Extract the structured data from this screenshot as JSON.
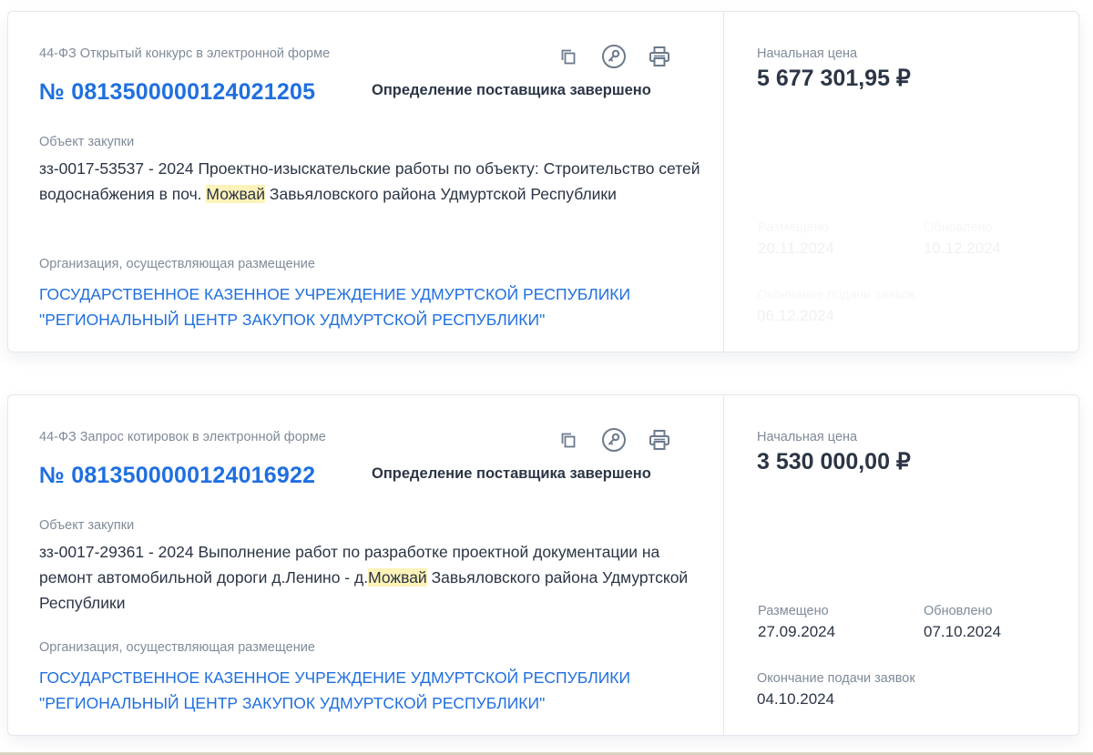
{
  "cards": [
    {
      "law_type": "44-ФЗ Открытый конкурс в электронной форме",
      "reg_number": "№ 0813500000124021205",
      "status": "Определение поставщика завершено",
      "object_label": "Объект закупки",
      "object_text_before": "зз-0017-53537 - 2024 Проектно-изыскательские работы по объекту: Строительство сетей водоснабжения в поч. ",
      "object_highlight": "Можвай",
      "object_text_after": " Завьяловского района Удмуртской Республики",
      "org_label": "Организация, осуществляющая размещение",
      "org_name": "ГОСУДАРСТВЕННОЕ КАЗЕННОЕ УЧРЕЖДЕНИЕ УДМУРТСКОЙ РЕСПУБЛИКИ \"РЕГИОНАЛЬНЫЙ ЦЕНТР ЗАКУПОК УДМУРТСКОЙ РЕСПУБЛИКИ\"",
      "price_label": "Начальная цена",
      "price": "5 677 301,95 ₽",
      "placed_label": "Размещено",
      "placed_date": "20.11.2024",
      "updated_label": "Обновлено",
      "updated_date": "10.12.2024",
      "end_label": "Окончание подачи заявок",
      "end_date": "06.12.2024"
    },
    {
      "law_type": "44-ФЗ Запрос котировок в электронной форме",
      "reg_number": "№ 0813500000124016922",
      "status": "Определение поставщика завершено",
      "object_label": "Объект закупки",
      "object_text_before": "зз-0017-29361 - 2024 Выполнение работ по разработке проектной документации на ремонт автомобильной дороги д.Ленино - д.",
      "object_highlight": "Можвай",
      "object_text_after": " Завьяловского района Удмуртской Республики",
      "org_label": "Организация, осуществляющая размещение",
      "org_name": "ГОСУДАРСТВЕННОЕ КАЗЕННОЕ УЧРЕЖДЕНИЕ УДМУРТСКОЙ РЕСПУБЛИКИ \"РЕГИОНАЛЬНЫЙ ЦЕНТР ЗАКУПОК УДМУРТСКОЙ РЕСПУБЛИКИ\"",
      "price_label": "Начальная цена",
      "price": "3 530 000,00 ₽",
      "placed_label": "Размещено",
      "placed_date": "27.09.2024",
      "updated_label": "Обновлено",
      "updated_date": "07.10.2024",
      "end_label": "Окончание подачи заявок",
      "end_date": "04.10.2024"
    }
  ],
  "icons": {
    "copy": "copy-icon",
    "key": "key-icon",
    "print": "print-icon"
  },
  "colors": {
    "link": "#1f6fe0",
    "text": "#2b3545",
    "muted": "#7f8b99",
    "highlight": "#fdf2b8",
    "icon": "#6c7a8c"
  }
}
